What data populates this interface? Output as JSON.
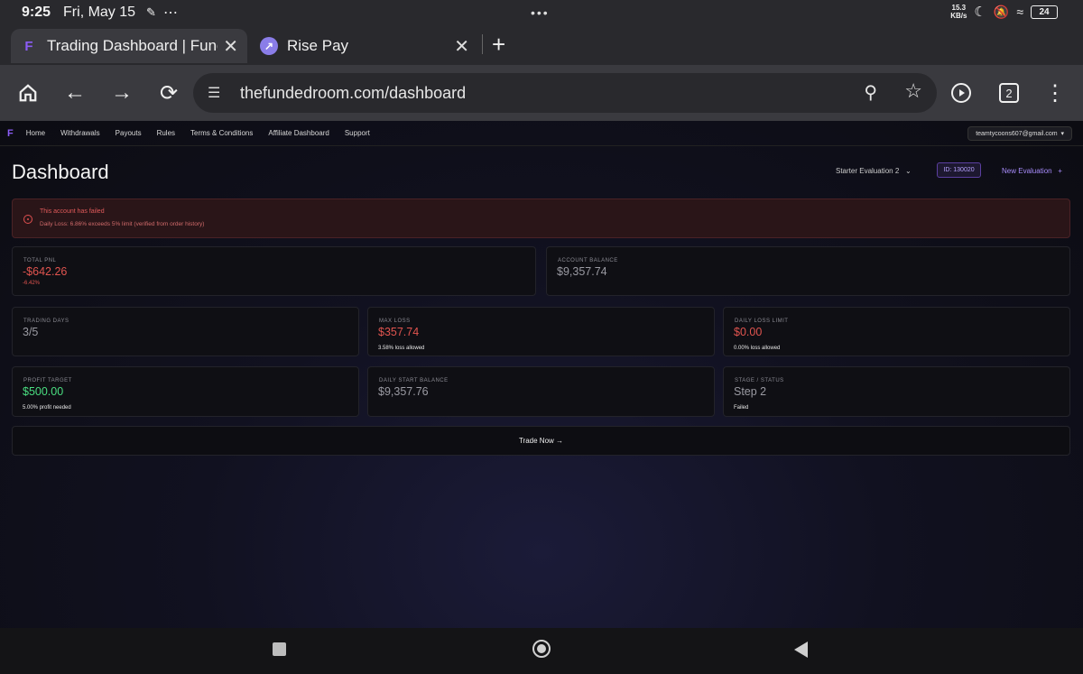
{
  "status": {
    "time": "9:25",
    "date": "Fri, May 15",
    "more": "•••",
    "net_speed": "15.3\nKB/s",
    "battery": "24"
  },
  "tabs": [
    {
      "title": "Trading Dashboard | Funded",
      "favicon": "F"
    },
    {
      "title": "Rise Pay",
      "favicon": "↗"
    }
  ],
  "toolbar": {
    "url": "thefundedroom.com/dashboard",
    "tab_count": "2"
  },
  "nav": {
    "logo": "F",
    "links": [
      "Home",
      "Withdrawals",
      "Payouts",
      "Rules",
      "Terms & Conditions",
      "Affiliate Dashboard",
      "Support"
    ],
    "email": "teamtycoons607@gmail.com"
  },
  "header": {
    "title": "Dashboard",
    "account_selector": "Starter Evaluation 2",
    "account_id": "ID: 130020",
    "new_evaluation": "New Evaluation"
  },
  "alert": {
    "title": "This account has failed",
    "message": "Daily Loss: 6.86% exceeds 5% limit (verified from order history)"
  },
  "cards": {
    "total_pnl": {
      "label": "TOTAL PNL",
      "value": "-$642.26",
      "sub": "-6.42%"
    },
    "account_balance": {
      "label": "ACCOUNT BALANCE",
      "value": "$9,357.74"
    },
    "trading_days": {
      "label": "TRADING DAYS",
      "value": "3/5"
    },
    "max_loss": {
      "label": "MAX LOSS",
      "value": "$357.74",
      "sub": "3.58% loss allowed"
    },
    "daily_loss_limit": {
      "label": "DAILY LOSS LIMIT",
      "value": "$0.00",
      "sub": "0.00% loss allowed"
    },
    "profit_target": {
      "label": "PROFIT TARGET",
      "value": "$500.00",
      "sub": "5.00% profit needed"
    },
    "daily_start_balance": {
      "label": "DAILY START BALANCE",
      "value": "$9,357.76"
    },
    "stage_status": {
      "label": "STAGE / STATUS",
      "value": "Step 2",
      "sub": "Failed"
    }
  },
  "trade_button": "Trade Now →",
  "colors": {
    "accent": "#8b5cf6",
    "loss": "#e0544f",
    "profit": "#4ade80"
  }
}
